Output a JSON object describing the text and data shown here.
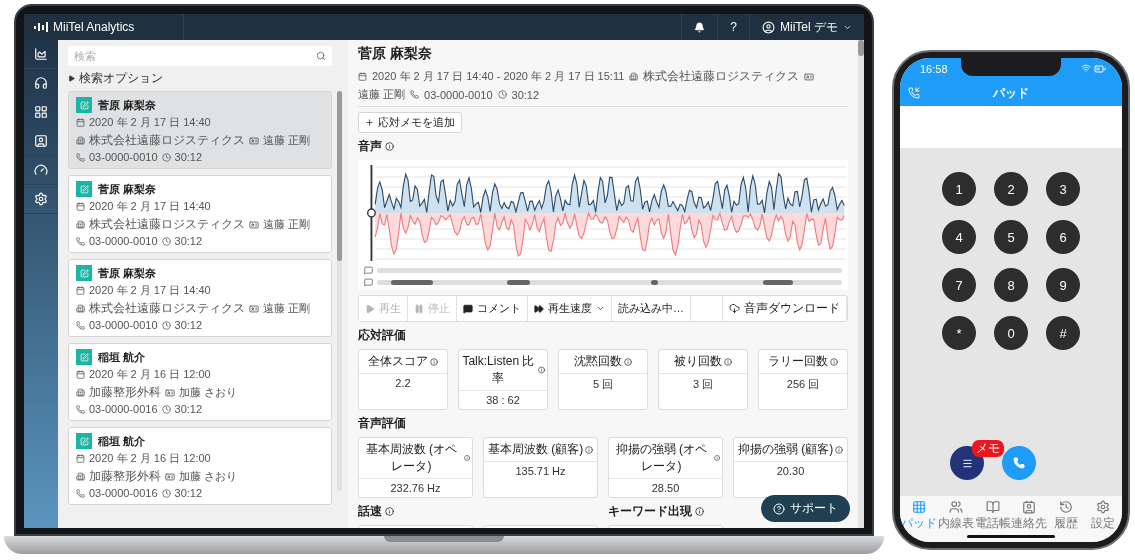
{
  "app": {
    "logo": "MiiTel Analytics",
    "help": "?",
    "user": "MiiTel デモ"
  },
  "search": {
    "placeholder": "検索"
  },
  "search_options": "検索オプション",
  "calls": [
    {
      "name": "菅原 麻梨奈",
      "date": "2020 年 2 月 17 日 14:40",
      "company": "株式会社遠藤ロジスティクス",
      "contact": "遠藤 正剛",
      "phone": "03-0000-0010",
      "duration": "30:12",
      "selected": true
    },
    {
      "name": "菅原 麻梨奈",
      "date": "2020 年 2 月 17 日 14:40",
      "company": "株式会社遠藤ロジスティクス",
      "contact": "遠藤 正剛",
      "phone": "03-0000-0010",
      "duration": "30:12",
      "selected": false
    },
    {
      "name": "菅原 麻梨奈",
      "date": "2020 年 2 月 17 日 14:40",
      "company": "株式会社遠藤ロジスティクス",
      "contact": "遠藤 正剛",
      "phone": "03-0000-0010",
      "duration": "30:12",
      "selected": false
    },
    {
      "name": "稲垣 航介",
      "date": "2020 年 2 月 16 日 12:00",
      "company": "加藤整形外科",
      "contact": "加藤 さおり",
      "phone": "03-0000-0016",
      "duration": "30:12",
      "selected": false
    },
    {
      "name": "稲垣 航介",
      "date": "2020 年 2 月 16 日 12:00",
      "company": "加藤整形外科",
      "contact": "加藤 さおり",
      "phone": "03-0000-0016",
      "duration": "30:12",
      "selected": false
    }
  ],
  "detail": {
    "title": "菅原 麻梨奈",
    "period": "2020 年 2 月 17 日 14:40 - 2020 年 2 月 17 日 15:11",
    "company": "株式会社遠藤ロジスティクス",
    "contact": "遠藤 正剛",
    "phone": "03-0000-0010",
    "duration": "30:12",
    "add_memo": "応対メモを追加",
    "audio_heading": "音声",
    "controls": [
      {
        "kind": "play",
        "label": "再生",
        "disabled": true
      },
      {
        "kind": "stop",
        "label": "停止",
        "disabled": true
      },
      {
        "kind": "comment",
        "label": "コメント",
        "disabled": false
      },
      {
        "kind": "speed",
        "label": "再生速度",
        "disabled": false
      },
      {
        "kind": "status",
        "label": "読み込み中…",
        "disabled": false
      },
      {
        "kind": "download",
        "label": "音声ダウンロード",
        "disabled": false
      }
    ],
    "sections": [
      {
        "heading": "応対評価",
        "metrics": [
          {
            "label": "全体スコア",
            "value": "2.2"
          },
          {
            "label": "Talk:Listen 比率",
            "value": "38 : 62"
          },
          {
            "label": "沈黙回数",
            "value": "5 回"
          },
          {
            "label": "被り回数",
            "value": "3 回"
          },
          {
            "label": "ラリー回数",
            "value": "256 回"
          }
        ]
      },
      {
        "heading": "音声評価",
        "metrics": [
          {
            "label": "基本周波数 (オペレータ)",
            "value": "232.76 Hz"
          },
          {
            "label": "基本周波数 (顧客)",
            "value": "135.71 Hz"
          },
          {
            "label": "抑揚の強弱 (オペレータ)",
            "value": "28.50"
          },
          {
            "label": "抑揚の強弱 (顧客)",
            "value": "20.30"
          }
        ]
      }
    ],
    "bottom_headings": [
      "話速",
      "キーワード出現"
    ]
  },
  "support": "サポート",
  "phone": {
    "time": "16:58",
    "title": "パッド",
    "keys": [
      "1",
      "2",
      "3",
      "4",
      "5",
      "6",
      "7",
      "8",
      "9",
      "*",
      "0",
      "#"
    ],
    "memo_badge": "メモ",
    "tabs": [
      {
        "kind": "pad",
        "label": "パッド",
        "selected": true
      },
      {
        "kind": "extensions",
        "label": "内線表",
        "selected": false
      },
      {
        "kind": "phonebook",
        "label": "電話帳",
        "selected": false
      },
      {
        "kind": "contacts",
        "label": "連絡先",
        "selected": false
      },
      {
        "kind": "history",
        "label": "履歴",
        "selected": false
      },
      {
        "kind": "settings",
        "label": "設定",
        "selected": false
      }
    ]
  }
}
